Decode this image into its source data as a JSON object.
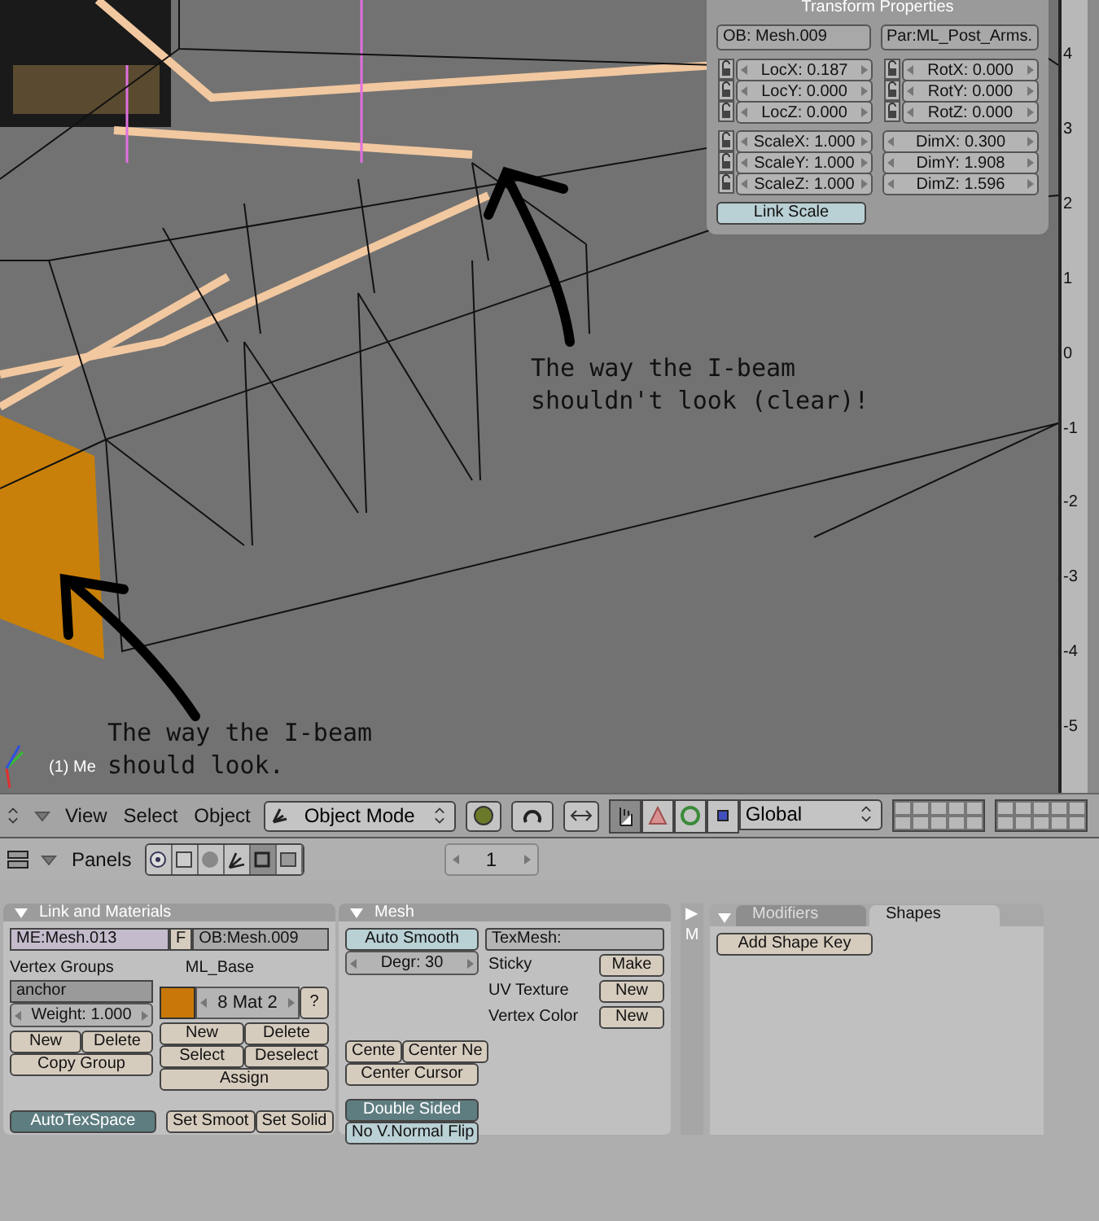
{
  "viewport": {
    "object_label": "(1) Me",
    "annotations": [
      {
        "lines": [
          "The way the I-beam",
          "shouldn't look (clear)!"
        ]
      },
      {
        "lines": [
          "The way the I-beam",
          "should look."
        ]
      }
    ],
    "ruler": [
      "4",
      "3",
      "2",
      "1",
      "0",
      "-1",
      "-2",
      "-3",
      "-4",
      "-5"
    ]
  },
  "transform_panel": {
    "title": "Transform Properties",
    "object": "OB: Mesh.009",
    "parent": "Par:ML_Post_Arms.",
    "groups": [
      [
        {
          "kind": "lockable",
          "text": "LocX: 0.187"
        },
        {
          "kind": "lockable",
          "text": "RotX: 0.000"
        },
        {
          "kind": "lockable",
          "text": "LocY: 0.000"
        },
        {
          "kind": "lockable",
          "text": "RotY: 0.000"
        },
        {
          "kind": "lockable",
          "text": "LocZ: 0.000"
        },
        {
          "kind": "lockable",
          "text": "RotZ: 0.000"
        }
      ],
      [
        {
          "kind": "lockable",
          "text": "ScaleX: 1.000"
        },
        {
          "kind": "plain",
          "text": "DimX: 0.300"
        },
        {
          "kind": "lockable",
          "text": "ScaleY: 1.000"
        },
        {
          "kind": "plain",
          "text": "DimY: 1.908"
        },
        {
          "kind": "lockable",
          "text": "ScaleZ: 1.000"
        },
        {
          "kind": "plain",
          "text": "DimZ: 1.596"
        }
      ]
    ],
    "link_scale": {
      "label": "Link Scale",
      "on": false
    }
  },
  "header": {
    "menus": [
      "View",
      "Select",
      "Object"
    ],
    "mode": "Object Mode",
    "manipulators": [
      {
        "kind": "hand",
        "on": true
      },
      {
        "kind": "translate",
        "on": false
      },
      {
        "kind": "rotate",
        "on": false
      },
      {
        "kind": "scale",
        "on": false
      }
    ],
    "orientation": "Global"
  },
  "buttons_header": {
    "panels_label": "Panels",
    "contexts": [
      {
        "kind": "logic",
        "selected": false
      },
      {
        "kind": "script",
        "selected": false
      },
      {
        "kind": "shading",
        "selected": false
      },
      {
        "kind": "object",
        "selected": false
      },
      {
        "kind": "editing",
        "selected": true
      },
      {
        "kind": "scene",
        "selected": false
      }
    ],
    "frame": "1"
  },
  "link_materials": {
    "title": "Link and Materials",
    "mesh": "ME:Mesh.013",
    "fake": "F",
    "object": "OB:Mesh.009",
    "vertex_groups_label": "Vertex Groups",
    "group": "anchor",
    "weight": "Weight: 1.000",
    "group_buttons": [
      "New",
      "Delete"
    ],
    "copy_group": "Copy Group",
    "material_label": "ML_Base",
    "material": "8 Mat 2",
    "help": "?",
    "material_buttons": [
      "New",
      "Delete",
      "Select",
      "Deselect"
    ],
    "assign": "Assign",
    "autotexspace": {
      "label": "AutoTexSpace",
      "on": true
    },
    "smooth_buttons": [
      "Set Smoot",
      "Set Solid"
    ]
  },
  "mesh": {
    "title": "Mesh",
    "auto_smooth": {
      "label": "Auto Smooth",
      "on": false
    },
    "degr": "Degr: 30",
    "center_buttons": [
      "Cente",
      "Center Ne"
    ],
    "center_cursor": "Center Cursor",
    "double_sided": {
      "label": "Double Sided",
      "on": true
    },
    "normal_flip": {
      "label": "No V.Normal Flip",
      "on": false
    },
    "texmesh": "TexMesh:",
    "rows": [
      {
        "label": "Sticky",
        "button": "Make"
      },
      {
        "label": "UV Texture",
        "button": "New"
      },
      {
        "label": "Vertex Color",
        "button": "New"
      }
    ]
  },
  "side_strip": {
    "arrow": "▶",
    "letter": "M"
  },
  "modifiers": {
    "tabs": [
      {
        "label": "Modifiers",
        "selected": false
      },
      {
        "label": "Shapes",
        "selected": true
      }
    ],
    "add_shape_key": "Add Shape Key"
  }
}
